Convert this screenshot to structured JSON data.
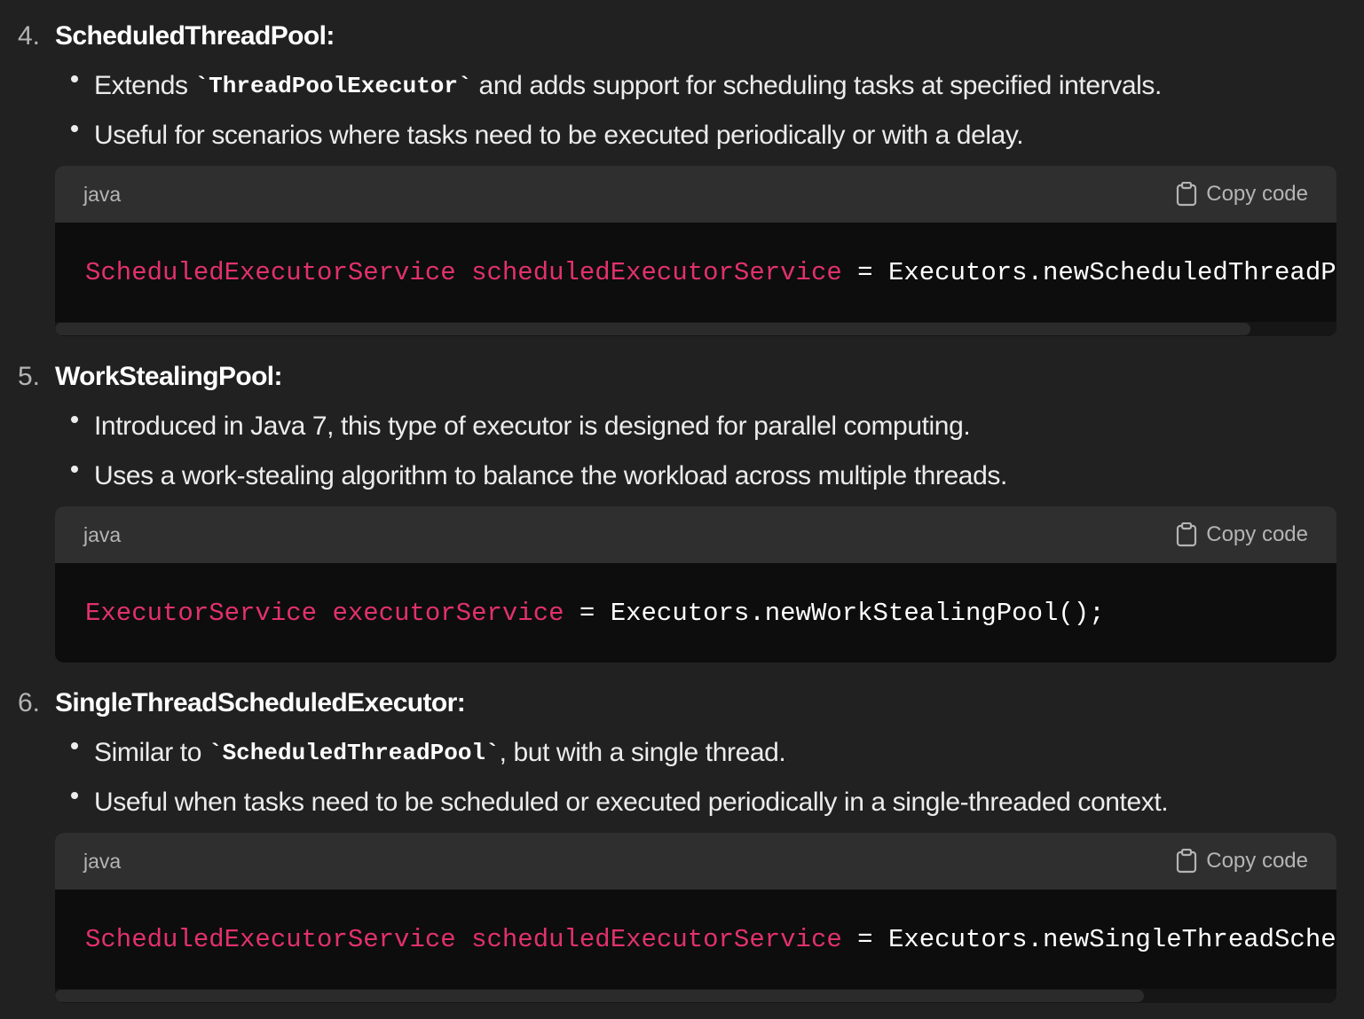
{
  "sections": [
    {
      "number": "4.",
      "title": "ScheduledThreadPool:",
      "bullets": [
        {
          "pre": "Extends ",
          "code": "`ThreadPoolExecutor`",
          "post": " and adds support for scheduling tasks at specified intervals."
        },
        {
          "pre": "Useful for scenarios where tasks need to be executed periodically or with a delay.",
          "code": "",
          "post": ""
        }
      ],
      "code": {
        "language": "java",
        "copy_label": "Copy code",
        "type": "ScheduledExecutorService",
        "var": "scheduledExecutorService",
        "rest": " = Executors.newScheduledThreadPool"
      }
    },
    {
      "number": "5.",
      "title": "WorkStealingPool:",
      "bullets": [
        {
          "pre": "Introduced in Java 7, this type of executor is designed for parallel computing.",
          "code": "",
          "post": ""
        },
        {
          "pre": "Uses a work-stealing algorithm to balance the workload across multiple threads.",
          "code": "",
          "post": ""
        }
      ],
      "code": {
        "language": "java",
        "copy_label": "Copy code",
        "type": "ExecutorService",
        "var": "executorService",
        "rest": " = Executors.newWorkStealingPool();"
      }
    },
    {
      "number": "6.",
      "title": "SingleThreadScheduledExecutor:",
      "bullets": [
        {
          "pre": "Similar to ",
          "code": "`ScheduledThreadPool`",
          "post": ", but with a single thread."
        },
        {
          "pre": "Useful when tasks need to be scheduled or executed periodically in a single-threaded context.",
          "code": "",
          "post": ""
        }
      ],
      "code": {
        "language": "java",
        "copy_label": "Copy code",
        "type": "ScheduledExecutorService",
        "var": "scheduledExecutorService",
        "rest": " = Executors.newSingleThreadSchedul"
      }
    }
  ],
  "colors": {
    "background": "#212121",
    "code_header": "#2f2f2f",
    "code_body": "#0d0d0d",
    "keyword": "#e2316c"
  },
  "icons": {
    "copy": "clipboard-icon"
  }
}
